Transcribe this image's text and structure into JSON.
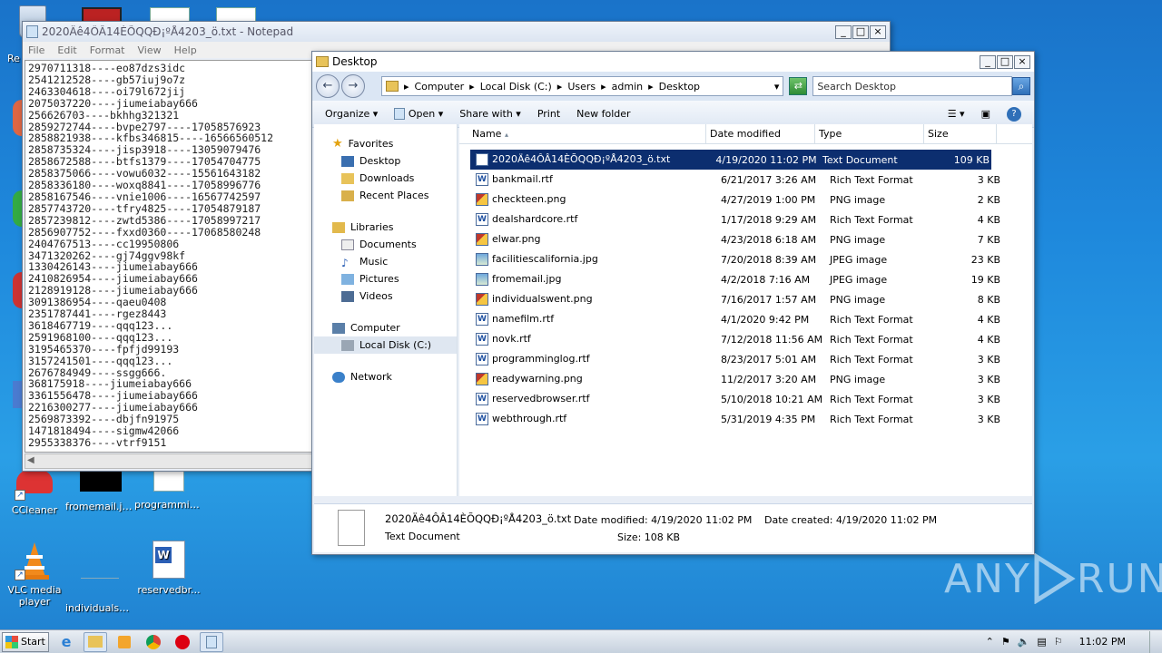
{
  "desktop": {
    "icons": [
      {
        "label": "Re"
      },
      {
        "label": "CCleaner"
      },
      {
        "label": "fromemail.jpg"
      },
      {
        "label": "programmin..."
      },
      {
        "label": "VLC media player"
      },
      {
        "label": "individualsw..."
      },
      {
        "label": "reservedbr..."
      }
    ]
  },
  "notepad": {
    "title": "2020Äê4ÔÂ14ÈÕQQÐ¡ºÅ4203_ö.txt - Notepad",
    "menu": [
      "File",
      "Edit",
      "Format",
      "View",
      "Help"
    ],
    "lines": [
      "2970711318----eo87dzs3idc",
      "2541212528----gb57iuj9o7z",
      "2463304618----oi79l672jij",
      "2075037220----jiumeiabay666",
      "256626703----bkhhg321321",
      "2859272744----bvpe2797----17058576923",
      "2858821938----kfbs346815----16566560512",
      "2858735324----jisp3918----13059079476",
      "2858672588----btfs1379----17054704775",
      "2858375066----vowu6032----15561643182",
      "2858336180----woxq8841----17058996776",
      "2858167546----vnie1006----16567742597",
      "2857743720----tfry4825----17054879187",
      "2857239812----zwtd5386----17058997217",
      "2856907752----fxxd0360----17068580248",
      "2404767513----cc19950806",
      "3471320262----gj74ggv98kf",
      "1330426143----jiumeiabay666",
      "2410826954----jiumeiabay666",
      "2128919128----jiumeiabay666",
      "3091386954----qaeu0408",
      "2351787441----rgez8443",
      "3618467719----qqq123...",
      "2591968100----qqq123...",
      "3195465370----fpfjd99193",
      "3157241501----qqq123...",
      "2676784949----ssgg666.",
      "368175918----jiumeiabay666",
      "3361556478----jiumeiabay666",
      "2216300277----jiumeiabay666",
      "2569873392----dbjfn91975",
      "1471818494----sigmw42066",
      "2955338376----vtrf9151"
    ]
  },
  "explorer": {
    "title": "Desktop",
    "breadcrumb": [
      "Computer",
      "Local Disk (C:)",
      "Users",
      "admin",
      "Desktop"
    ],
    "search_placeholder": "Search Desktop",
    "toolbar": {
      "organize": "Organize",
      "open": "Open",
      "share": "Share with",
      "print": "Print",
      "new_folder": "New folder"
    },
    "nav": {
      "favorites": "Favorites",
      "desktop": "Desktop",
      "downloads": "Downloads",
      "recent": "Recent Places",
      "libraries": "Libraries",
      "documents": "Documents",
      "music": "Music",
      "pictures": "Pictures",
      "videos": "Videos",
      "computer": "Computer",
      "localdisk": "Local Disk (C:)",
      "network": "Network"
    },
    "columns": {
      "name": "Name",
      "date": "Date modified",
      "type": "Type",
      "size": "Size"
    },
    "files": [
      {
        "name": "2020Äê4ÔÂ14ÈÕQQÐ¡ºÅ4203_ö.txt",
        "date": "4/19/2020 11:02 PM",
        "type": "Text Document",
        "size": "109 KB",
        "icon": "txt"
      },
      {
        "name": "bankmail.rtf",
        "date": "6/21/2017 3:26 AM",
        "type": "Rich Text Format",
        "size": "3 KB",
        "icon": "rtf"
      },
      {
        "name": "checkteen.png",
        "date": "4/27/2019 1:00 PM",
        "type": "PNG image",
        "size": "2 KB",
        "icon": "img"
      },
      {
        "name": "dealshardcore.rtf",
        "date": "1/17/2018 9:29 AM",
        "type": "Rich Text Format",
        "size": "4 KB",
        "icon": "rtf"
      },
      {
        "name": "elwar.png",
        "date": "4/23/2018 6:18 AM",
        "type": "PNG image",
        "size": "7 KB",
        "icon": "img"
      },
      {
        "name": "facilitiescalifornia.jpg",
        "date": "7/20/2018 8:39 AM",
        "type": "JPEG image",
        "size": "23 KB",
        "icon": "jpg"
      },
      {
        "name": "fromemail.jpg",
        "date": "4/2/2018 7:16 AM",
        "type": "JPEG image",
        "size": "19 KB",
        "icon": "jpg"
      },
      {
        "name": "individualswent.png",
        "date": "7/16/2017 1:57 AM",
        "type": "PNG image",
        "size": "8 KB",
        "icon": "img"
      },
      {
        "name": "namefilm.rtf",
        "date": "4/1/2020 9:42 PM",
        "type": "Rich Text Format",
        "size": "4 KB",
        "icon": "rtf"
      },
      {
        "name": "novk.rtf",
        "date": "7/12/2018 11:56 AM",
        "type": "Rich Text Format",
        "size": "4 KB",
        "icon": "rtf"
      },
      {
        "name": "programminglog.rtf",
        "date": "8/23/2017 5:01 AM",
        "type": "Rich Text Format",
        "size": "3 KB",
        "icon": "rtf"
      },
      {
        "name": "readywarning.png",
        "date": "11/2/2017 3:20 AM",
        "type": "PNG image",
        "size": "3 KB",
        "icon": "img"
      },
      {
        "name": "reservedbrowser.rtf",
        "date": "5/10/2018 10:21 AM",
        "type": "Rich Text Format",
        "size": "3 KB",
        "icon": "rtf"
      },
      {
        "name": "webthrough.rtf",
        "date": "5/31/2019 4:35 PM",
        "type": "Rich Text Format",
        "size": "3 KB",
        "icon": "rtf"
      }
    ],
    "details": {
      "name": "2020Äê4ÔÂ14ÈÕQQÐ¡ºÅ4203_ö.txt",
      "type": "Text Document",
      "date_modified_label": "Date modified:",
      "date_modified": "4/19/2020 11:02 PM",
      "size_label": "Size:",
      "size": "108 KB",
      "date_created_label": "Date created:",
      "date_created": "4/19/2020 11:02 PM"
    }
  },
  "taskbar": {
    "start": "Start",
    "clock": "11:02 PM"
  },
  "watermark": {
    "left": "ANY",
    "right": "RUN"
  }
}
